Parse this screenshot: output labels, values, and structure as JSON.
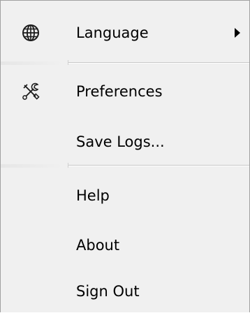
{
  "menu": {
    "items": [
      {
        "label": "Language",
        "icon": "globe-icon",
        "submenu": true
      },
      {
        "label": "Preferences",
        "icon": "tools-icon"
      },
      {
        "label": "Save Logs..."
      },
      {
        "label": "Help"
      },
      {
        "label": "About"
      },
      {
        "label": "Sign Out"
      }
    ]
  }
}
